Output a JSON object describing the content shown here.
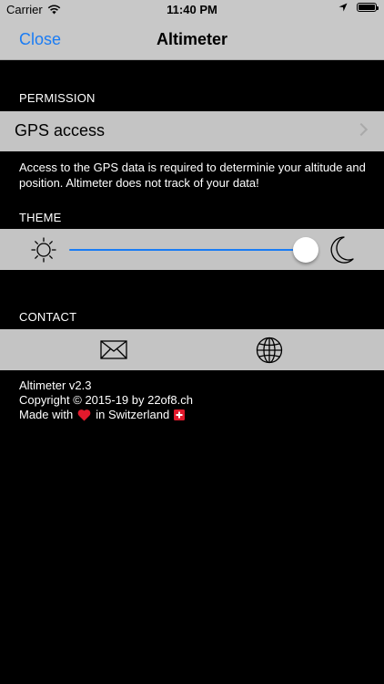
{
  "status_bar": {
    "carrier": "Carrier",
    "time": "11:40 PM",
    "icons": [
      "wifi-icon",
      "location-arrow-icon",
      "battery-icon"
    ]
  },
  "nav": {
    "close_label": "Close",
    "title": "Altimeter",
    "accent_color": "#1a7cf4"
  },
  "permission": {
    "header": "PERMISSION",
    "gps_label": "GPS access",
    "footnote": "Access to the GPS data is required to determinie your altitude and position. Altimeter does not track of your data!"
  },
  "theme": {
    "header": "THEME",
    "slider_value": 1.0,
    "icons": [
      "sun-icon",
      "moon-icon"
    ]
  },
  "contact": {
    "header": "CONTACT",
    "icons": [
      "mail-icon",
      "globe-icon"
    ]
  },
  "info": {
    "version": "Altimeter v2.3",
    "copyright": "Copyright © 2015-19 by 22of8.ch",
    "made_with_prefix": "Made with",
    "made_with_suffix": "in Switzerland",
    "emoji_icons": [
      "heart-icon",
      "swiss-flag-icon"
    ]
  }
}
